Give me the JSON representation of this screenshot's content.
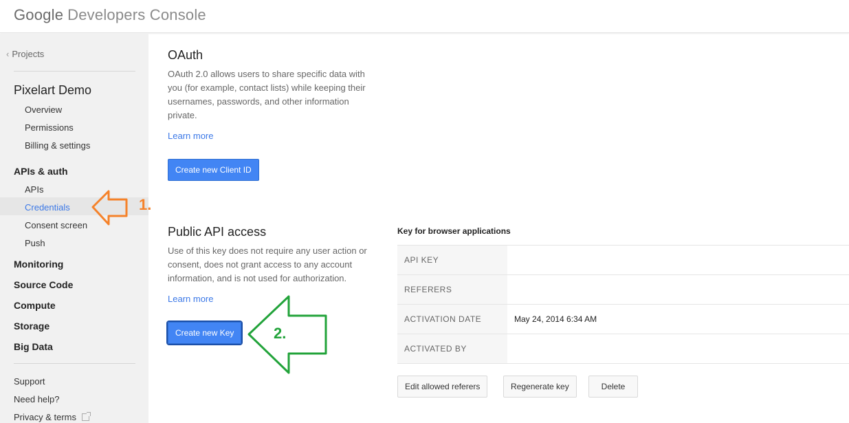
{
  "header": {
    "brand_google": "Google",
    "brand_product": "Developers Console"
  },
  "sidebar": {
    "back_label": "Projects",
    "project_name": "Pixelart Demo",
    "project_items": [
      "Overview",
      "Permissions",
      "Billing & settings"
    ],
    "apis_auth_heading": "APIs & auth",
    "apis_auth_items": [
      "APIs",
      "Credentials",
      "Consent screen",
      "Push"
    ],
    "active_item": "Credentials",
    "sections": [
      "Monitoring",
      "Source Code",
      "Compute",
      "Storage",
      "Big Data"
    ],
    "footer": {
      "support": "Support",
      "need_help": "Need help?",
      "privacy_terms": "Privacy & terms"
    }
  },
  "oauth": {
    "title": "OAuth",
    "description": "OAuth 2.0 allows users to share specific data with you (for example, contact lists) while keeping their usernames, passwords, and other information private.",
    "learn_more": "Learn more",
    "button_label": "Create new Client ID"
  },
  "public_api": {
    "title": "Public API access",
    "description": "Use of this key does not require any user action or consent, does not grant access to any account information, and is not used for authorization.",
    "learn_more": "Learn more",
    "button_label": "Create new Key"
  },
  "key_panel": {
    "title": "Key for browser applications",
    "rows": [
      {
        "label": "API KEY",
        "value": ""
      },
      {
        "label": "REFERERS",
        "value": ""
      },
      {
        "label": "ACTIVATION DATE",
        "value": "May 24, 2014 6:34 AM"
      },
      {
        "label": "ACTIVATED BY",
        "value": ""
      }
    ],
    "buttons": {
      "edit_referers": "Edit allowed referers",
      "regenerate": "Regenerate key",
      "delete": "Delete"
    }
  },
  "annotations": {
    "step1": "1.",
    "step2": "2.",
    "step1_color": "#f5822a",
    "step2_color": "#22a33a"
  },
  "colors": {
    "link_blue": "#3b78e7",
    "primary_button": "#4285f4",
    "sidebar_bg": "#f1f1f1"
  }
}
